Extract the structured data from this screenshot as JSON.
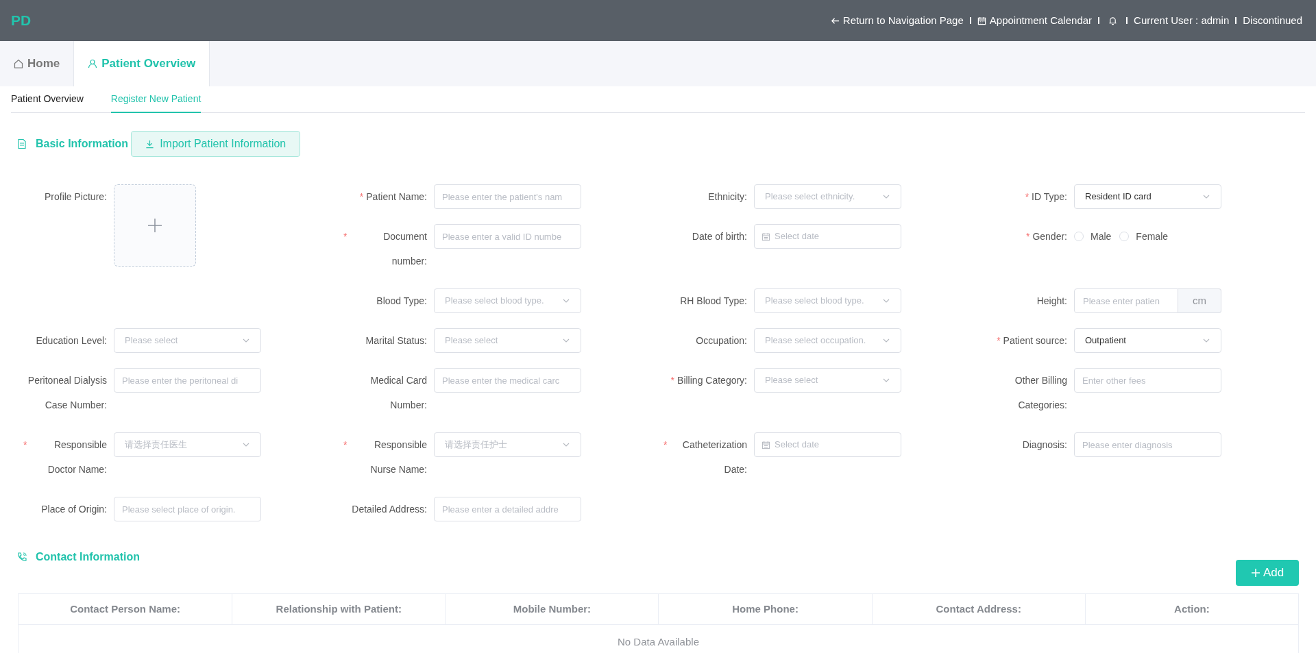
{
  "header": {
    "logo": "PD",
    "links": [
      {
        "kind": "back",
        "label": "Return to Navigation Page"
      },
      {
        "kind": "calendar",
        "label": "Appointment Calendar"
      },
      {
        "kind": "bell"
      },
      {
        "kind": "text",
        "label": "Current User : admin"
      },
      {
        "kind": "text",
        "label": "Discontinued"
      }
    ]
  },
  "tabs": [
    {
      "kind": "home",
      "label": "Home",
      "selected": false
    },
    {
      "kind": "user",
      "label": "Patient Overview",
      "selected": true
    }
  ],
  "subtabs": [
    {
      "label": "Patient Overview",
      "selected": false
    },
    {
      "label": "Register New Patient",
      "selected": true
    }
  ],
  "basic_information": {
    "title": "Basic Information",
    "import_button": "Import Patient Information",
    "fields": [
      {
        "kind": "upload",
        "label": "Profile Picture:"
      },
      {
        "kind": "input",
        "required_mark": "*",
        "label": "Patient Name:",
        "placeholder": "Please enter the patient's nam"
      },
      {
        "kind": "select",
        "label": "Ethnicity:",
        "placeholder": "Please select ethnicity."
      },
      {
        "kind": "select",
        "required_mark": "*",
        "label": "ID Type:",
        "value": "Resident ID card"
      },
      {
        "kind": "input",
        "required_mark": "*",
        "label": "Document number:",
        "placeholder": "Please enter a valid ID numbe"
      },
      {
        "kind": "date",
        "label": "Date of birth:",
        "placeholder": "Select date"
      },
      {
        "kind": "radio",
        "required_mark": "*",
        "label": "Gender:",
        "options": [
          {
            "label": "Male",
            "selected": false
          },
          {
            "label": "Female",
            "selected": false
          }
        ]
      },
      {
        "kind": "select",
        "label": "Blood Type:",
        "placeholder": "Please select blood type."
      },
      {
        "kind": "select",
        "label": "RH Blood Type:",
        "placeholder": "Please select blood type."
      },
      {
        "kind": "suffix",
        "label": "Height:",
        "placeholder": "Please enter patien",
        "suffix": "cm"
      },
      {
        "kind": "select",
        "label": "Education Level:",
        "placeholder": "Please select"
      },
      {
        "kind": "select",
        "label": "Marital Status:",
        "placeholder": "Please select"
      },
      {
        "kind": "select",
        "label": "Occupation:",
        "placeholder": "Please select occupation."
      },
      {
        "kind": "select",
        "required_mark": "*",
        "label": "Patient source:",
        "value": "Outpatient"
      },
      {
        "kind": "input",
        "label": "Peritoneal Dialysis Case Number:",
        "placeholder": "Please enter the peritoneal di"
      },
      {
        "kind": "input",
        "label": "Medical Card Number:",
        "placeholder": "Please enter the medical carc"
      },
      {
        "kind": "select",
        "required_mark": "*",
        "label": "Billing Category:",
        "placeholder": "Please select"
      },
      {
        "kind": "input",
        "label": "Other Billing Categories:",
        "placeholder": "Enter other fees"
      },
      {
        "kind": "select",
        "required_mark": "*",
        "label": "Responsible Doctor Name:",
        "placeholder": "请选择责任医生"
      },
      {
        "kind": "select",
        "required_mark": "*",
        "label": "Responsible Nurse Name:",
        "placeholder": "请选择责任护士"
      },
      {
        "kind": "date",
        "required_mark": "*",
        "label": "Catheterization Date:",
        "placeholder": "Select date"
      },
      {
        "kind": "input",
        "label": "Diagnosis:",
        "placeholder": "Please enter diagnosis"
      },
      {
        "kind": "input",
        "label": "Place of Origin:",
        "placeholder": "Please select place of origin."
      },
      {
        "kind": "input",
        "label": "Detailed Address:",
        "placeholder": "Please enter a detailed addre"
      }
    ]
  },
  "contact_information": {
    "title": "Contact Information",
    "add_button": "Add",
    "table": {
      "columns": [
        "Contact Person Name:",
        "Relationship with Patient:",
        "Mobile Number:",
        "Home Phone:",
        "Contact Address:",
        "Action:"
      ],
      "empty_text": "No Data Available"
    }
  }
}
